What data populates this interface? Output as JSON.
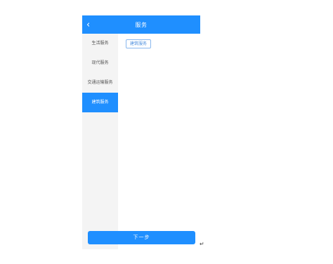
{
  "header": {
    "back_icon": "chevron-left-icon",
    "back_glyph": "‹",
    "title": "服务"
  },
  "sidebar": {
    "items": [
      {
        "label": "生活服务",
        "active": false
      },
      {
        "label": "现代服务",
        "active": false
      },
      {
        "label": "交通运输服务",
        "active": false
      },
      {
        "label": "建筑服务",
        "active": true
      }
    ]
  },
  "content": {
    "tags": [
      {
        "label": "建筑服务"
      }
    ]
  },
  "footer": {
    "next_label": "下一步"
  },
  "page_mark": "↵",
  "colors": {
    "accent": "#1f8fff",
    "sidebar_bg": "#f4f4f4",
    "tag_border": "#8ab8ee"
  }
}
